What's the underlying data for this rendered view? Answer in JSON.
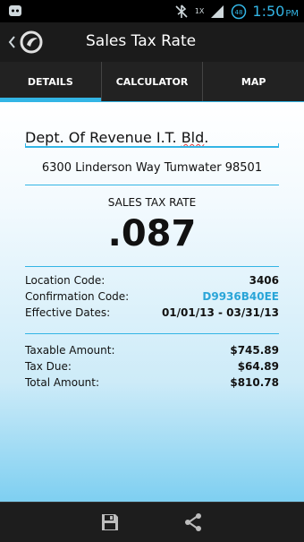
{
  "status_bar": {
    "time": "1:50",
    "ampm": "PM",
    "network_badge": "1X",
    "icons": [
      "android-icon",
      "cast-icon",
      "signal-icon",
      "battery-icon"
    ]
  },
  "app_bar": {
    "title": "Sales Tax Rate",
    "icons": [
      "back-chevron-icon",
      "app-logo-icon"
    ]
  },
  "tabs": [
    {
      "label": "DETAILS",
      "active": true
    },
    {
      "label": "CALCULATOR",
      "active": false
    },
    {
      "label": "MAP",
      "active": false
    }
  ],
  "details": {
    "location_name_prefix": "Dept. Of Revenue I.T. ",
    "location_name_suffix": "Bld",
    "location_name_end": ".",
    "address": "6300 Linderson Way Tumwater 98501",
    "rate_label": "SALES TAX RATE",
    "rate_value": ".087",
    "fields": [
      {
        "label": "Location Code:",
        "value": "3406"
      },
      {
        "label": "Confirmation Code:",
        "value": "D9936B40EE"
      },
      {
        "label": "Effective Dates:",
        "value": "01/01/13 - 03/31/13"
      }
    ],
    "totals": [
      {
        "label": "Taxable Amount:",
        "value": "$745.89"
      },
      {
        "label": "Tax Due:",
        "value": "$64.89"
      },
      {
        "label": "Total Amount:",
        "value": "$810.78"
      }
    ]
  },
  "bottom_bar": {
    "icons": [
      "save-icon",
      "share-icon"
    ]
  },
  "colors": {
    "accent": "#33b5e5",
    "link": "#2aa5d8",
    "spell_error": "#e53935"
  }
}
